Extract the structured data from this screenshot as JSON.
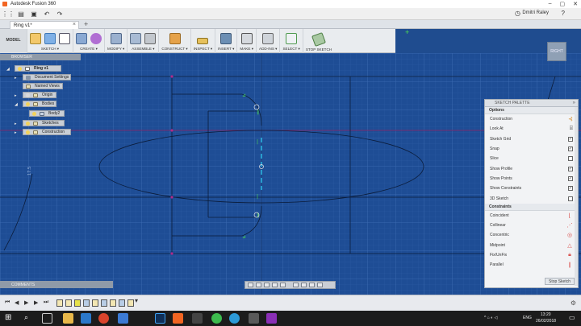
{
  "window": {
    "title": "Autodesk Fusion 360"
  },
  "quick_access": {
    "user": "Dmitri Raley"
  },
  "tab": {
    "name": "Ring v1*"
  },
  "toolbar": {
    "model_label": "MODEL",
    "groups": [
      {
        "label": "SKETCH ▾"
      },
      {
        "label": "CREATE ▾"
      },
      {
        "label": "MODIFY ▾"
      },
      {
        "label": "ASSEMBLE ▾"
      },
      {
        "label": "CONSTRUCT ▾"
      },
      {
        "label": "INSPECT ▾"
      },
      {
        "label": "INSERT ▾"
      },
      {
        "label": "MAKE ▾"
      },
      {
        "label": "ADD-INS ▾"
      },
      {
        "label": "SELECT ▾"
      },
      {
        "label": "STOP SKETCH"
      }
    ]
  },
  "browser": {
    "title": "BROWSER",
    "items": [
      {
        "label": "Ring v1"
      },
      {
        "label": "Document Settings"
      },
      {
        "label": "Named Views"
      },
      {
        "label": "Origin"
      },
      {
        "label": "Bodies"
      },
      {
        "label": "Body2"
      },
      {
        "label": "Sketches"
      },
      {
        "label": "Construction"
      }
    ]
  },
  "viewcube": {
    "label": "RIGHT"
  },
  "canvas": {
    "dimension_label": "17.5"
  },
  "sketch_palette": {
    "title": "SKETCH PALETTE",
    "options_header": "Options",
    "options": [
      {
        "label": "Construction",
        "checked": null
      },
      {
        "label": "Look At",
        "checked": null
      },
      {
        "label": "Sketch Grid",
        "checked": true
      },
      {
        "label": "Snap",
        "checked": true
      },
      {
        "label": "Slice",
        "checked": false
      },
      {
        "label": "Show Profile",
        "checked": true
      },
      {
        "label": "Show Points",
        "checked": true
      },
      {
        "label": "Show Constraints",
        "checked": true
      },
      {
        "label": "3D Sketch",
        "checked": false
      }
    ],
    "constraints_header": "Constraints",
    "constraints": [
      {
        "label": "Coincident",
        "icon": "coincident-icon"
      },
      {
        "label": "Collinear",
        "icon": "collinear-icon"
      },
      {
        "label": "Concentric",
        "icon": "concentric-icon"
      },
      {
        "label": "Midpoint",
        "icon": "midpoint-icon"
      },
      {
        "label": "Fix/UnFix",
        "icon": "lock-icon"
      },
      {
        "label": "Parallel",
        "icon": "parallel-icon"
      }
    ],
    "stop_button": "Stop Sketch"
  },
  "comments": {
    "label": "COMMENTS"
  },
  "taskbar": {
    "lang": "ENG",
    "time": "13:20",
    "date": "26/02/2018"
  },
  "colors": {
    "canvas": "#1e4d95",
    "toolbar": "#e9ecef",
    "accent": "#f26522"
  }
}
